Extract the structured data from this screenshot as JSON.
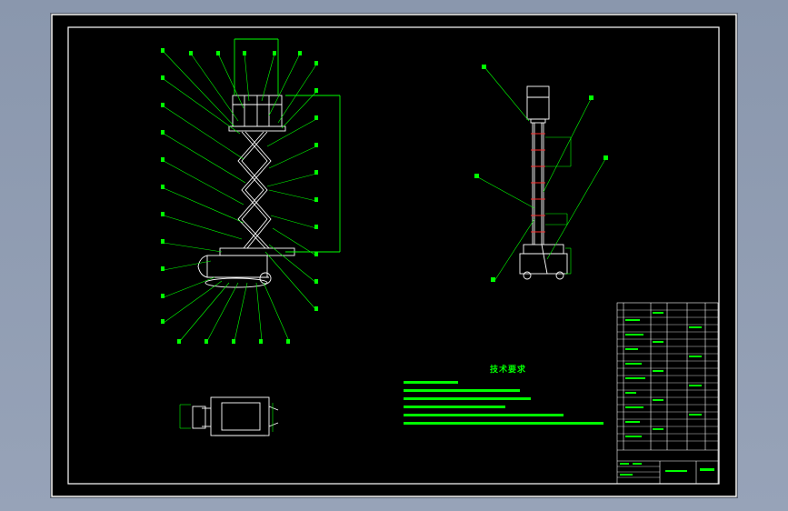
{
  "sheet": {
    "tech_requirements_title": "技术要求"
  },
  "colors": {
    "background": "#000000",
    "drawing_line": "#ffffff",
    "annotation": "#00ff00",
    "frame": "#ffffff",
    "viewport": "#8f9bb2"
  }
}
